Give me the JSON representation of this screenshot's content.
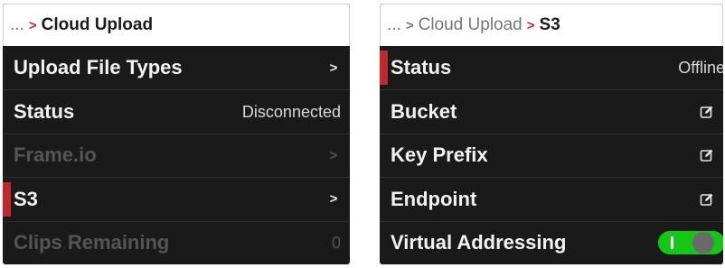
{
  "left_panel": {
    "breadcrumb": {
      "ellipsis": "...",
      "separator": ">",
      "current": "Cloud Upload"
    },
    "rows": [
      {
        "label": "Upload File Types",
        "value": "",
        "chevron": ">"
      },
      {
        "label": "Status",
        "value": "Disconnected"
      },
      {
        "label": "Frame.io",
        "chevron": ">"
      },
      {
        "label": "S3",
        "chevron": ">"
      },
      {
        "label": "Clips Remaining",
        "value": "0"
      }
    ]
  },
  "right_panel": {
    "breadcrumb": {
      "ellipsis": "...",
      "separator": ">",
      "parent": "Cloud Upload",
      "current": "S3"
    },
    "rows": [
      {
        "label": "Status",
        "value": "Offline"
      },
      {
        "label": "Bucket",
        "icon": "edit-icon"
      },
      {
        "label": "Key Prefix",
        "icon": "edit-icon"
      },
      {
        "label": "Endpoint",
        "icon": "edit-icon"
      },
      {
        "label": "Virtual Addressing",
        "toggle_state": true
      }
    ]
  },
  "colors": {
    "accent": "#c1272d",
    "panel_bg": "#1a1a1a",
    "toggle_on": "#16c616"
  }
}
